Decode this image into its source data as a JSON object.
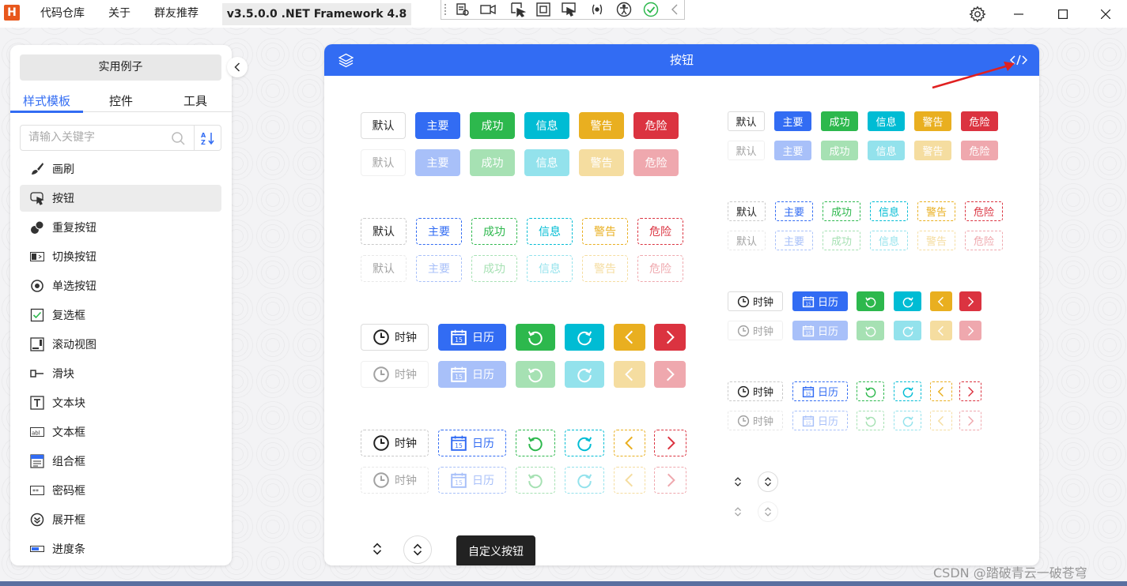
{
  "app": {
    "logo_letter": "H",
    "menu": [
      "代码仓库",
      "关于",
      "群友推荐"
    ],
    "version": "v3.5.0.0 .NET Framework 4.8"
  },
  "devtools": {
    "icons": [
      "grip-icon",
      "live-tree-icon",
      "record-icon",
      "select-element-icon",
      "display-layout-icon",
      "track-focus-icon",
      "binding-failures-icon",
      "accessibility-icon",
      "check-icon",
      "collapse-arrow-icon"
    ]
  },
  "left": {
    "examples_label": "实用例子",
    "tabs": [
      "样式模板",
      "控件",
      "工具"
    ],
    "search_placeholder": "请输入关键字",
    "items": [
      {
        "label": "画刷",
        "icon": "brush-icon"
      },
      {
        "label": "按钮",
        "icon": "button-icon"
      },
      {
        "label": "重复按钮",
        "icon": "repeat-button-icon"
      },
      {
        "label": "切换按钮",
        "icon": "toggle-button-icon"
      },
      {
        "label": "单选按钮",
        "icon": "radio-button-icon"
      },
      {
        "label": "复选框",
        "icon": "checkbox-icon"
      },
      {
        "label": "滚动视图",
        "icon": "scrollviewer-icon"
      },
      {
        "label": "滑块",
        "icon": "slider-icon"
      },
      {
        "label": "文本块",
        "icon": "textblock-icon"
      },
      {
        "label": "文本框",
        "icon": "textbox-icon"
      },
      {
        "label": "组合框",
        "icon": "combobox-icon"
      },
      {
        "label": "密码框",
        "icon": "passwordbox-icon"
      },
      {
        "label": "展开框",
        "icon": "expander-icon"
      },
      {
        "label": "进度条",
        "icon": "progressbar-icon"
      }
    ]
  },
  "card": {
    "title": "按钮"
  },
  "buttons": {
    "labels": [
      "默认",
      "主要",
      "成功",
      "信息",
      "警告",
      "危险"
    ],
    "clock": "时钟",
    "calendar": "日历",
    "calendar_day": "15",
    "custom": "自定义按钮"
  },
  "colors": {
    "primary": "#326cf3",
    "success": "#2db84d",
    "info": "#00bcd4",
    "warning": "#e9af20",
    "danger": "#db3340",
    "default_border": "#dcdcdc"
  },
  "watermark": "CSDN @踏破青云一破苍穹"
}
